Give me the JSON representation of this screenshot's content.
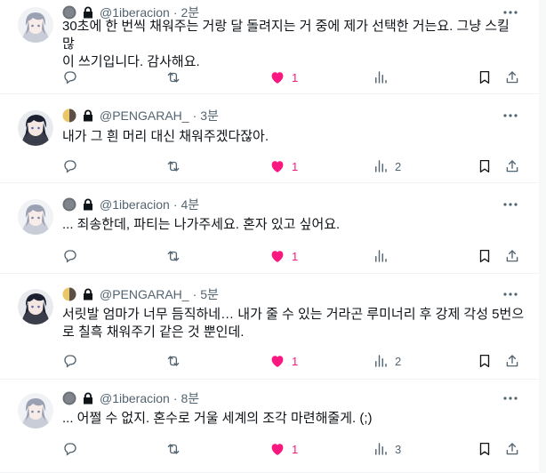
{
  "colors": {
    "like": "#f91880",
    "muted": "#536471",
    "text": "#0f1419",
    "border": "#eff3f4"
  },
  "tweets": [
    {
      "author": "1iberacion",
      "handle": "@1iberacion",
      "time": "2분",
      "badge_icon": "gray-circle-badge-icon",
      "avatar_style": "light",
      "text": "30초에 한 번씩 채워주는 거랑 달 돌려지는 거 중에 제가 선택한 거는요. 그냥 스킬 많\n이 쓰기입니다. 감사해요.",
      "likes": "1",
      "views": ""
    },
    {
      "author": "PENGARAH_",
      "handle": "@PENGARAH_",
      "time": "3분",
      "badge_icon": "half-moon-badge-icon",
      "avatar_style": "dark",
      "text": "내가 그 흰 머리 대신 채워주겠다잖아.",
      "likes": "1",
      "views": "2"
    },
    {
      "author": "1iberacion",
      "handle": "@1iberacion",
      "time": "4분",
      "badge_icon": "gray-circle-badge-icon",
      "avatar_style": "light",
      "text": "... 죄송한데, 파티는 나가주세요. 혼자 있고 싶어요.",
      "likes": "1",
      "views": ""
    },
    {
      "author": "PENGARAH_",
      "handle": "@PENGARAH_",
      "time": "5분",
      "badge_icon": "half-moon-badge-icon",
      "avatar_style": "dark",
      "text": "서릿발 엄마가 너무 듬직하네… 내가 줄 수 있는 거라곤 루미너리 후 강제 각성 5번으\n로 칠흑 채워주기 같은 것 뿐인데.",
      "likes": "1",
      "views": "2"
    },
    {
      "author": "1iberacion",
      "handle": "@1iberacion",
      "time": "8분",
      "badge_icon": "gray-circle-badge-icon",
      "avatar_style": "light",
      "text": "... 어쩔 수 없지. 혼수로 거울 세계의 조각 마련해줄게. (;)",
      "likes": "1",
      "views": "3"
    }
  ]
}
